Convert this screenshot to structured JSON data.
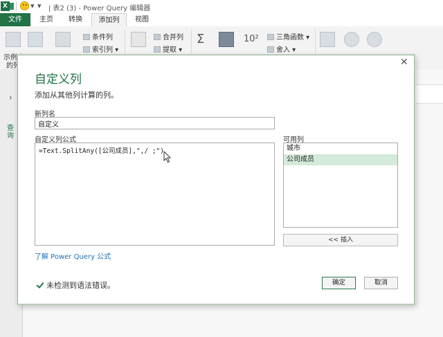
{
  "titlebar": {
    "title": "| 表2 (3) - Power Query 编辑器",
    "app_icon_letter": "X"
  },
  "tabs": [
    {
      "label": "文件"
    },
    {
      "label": "主页"
    },
    {
      "label": "转换"
    },
    {
      "label": "添加列"
    },
    {
      "label": "视图"
    }
  ],
  "ribbon": {
    "group1": {
      "label1": "示例中",
      "label2": "的列"
    },
    "conditional_column": "条件列",
    "index_column": "索引列 ▾",
    "merge_columns": "合并列",
    "extract": "提取 ▾",
    "trig": "三角函数 ▾",
    "rounding": "舍入 ▾"
  },
  "background": {
    "left_vertical_text": "查询"
  },
  "dialog": {
    "title": "自定义列",
    "subtitle": "添加从其他列计算的列。",
    "new_column_label": "新列名",
    "new_column_value": "自定义",
    "formula_label": "自定义列公式",
    "formula_value": "=Text.SplitAny([公司成员],\",/ ;\")",
    "available_label": "可用列",
    "available_columns": [
      "城市",
      "公司成员"
    ],
    "selected_column_index": 1,
    "insert_button": "<< 插入",
    "learn_link": "了解 Power Query 公式",
    "status_text": "未检测到语法错误。",
    "ok_button": "确定",
    "cancel_button": "取消"
  },
  "colors": {
    "accent": "#217346",
    "link": "#1f6fb5",
    "selection": "#d4eadb"
  }
}
